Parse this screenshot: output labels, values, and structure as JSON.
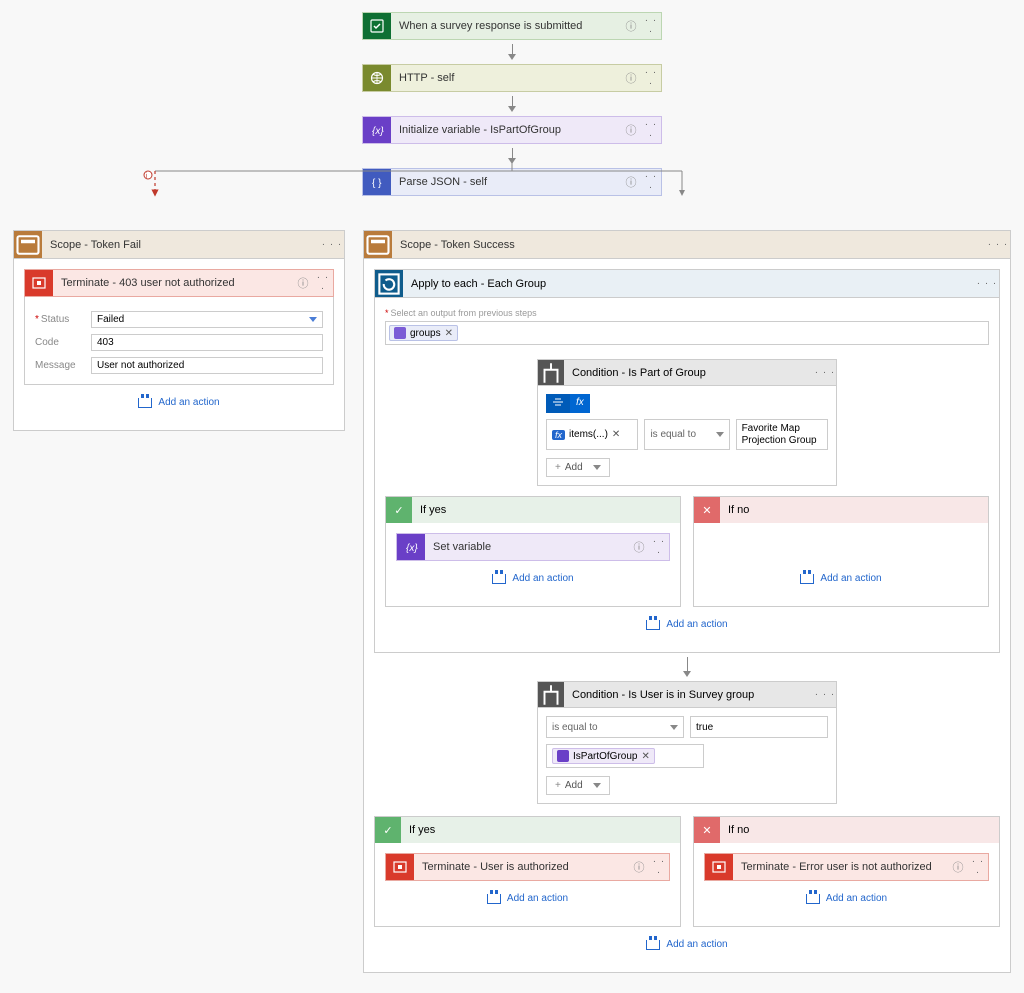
{
  "top": {
    "trigger": "When a survey response is submitted",
    "http": "HTTP - self",
    "initVar": "Initialize variable - IsPartOfGroup",
    "parse": "Parse JSON - self"
  },
  "scopeFail": {
    "title": "Scope - Token Fail",
    "terminate": {
      "title": "Terminate - 403 user not authorized",
      "fields": {
        "statusLabel": "Status",
        "status": "Failed",
        "codeLabel": "Code",
        "code": "403",
        "messageLabel": "Message",
        "message": "User not authorized"
      }
    },
    "addAction": "Add an action"
  },
  "scopeSuccess": {
    "title": "Scope - Token Success",
    "applyEach": {
      "title": "Apply to each - Each Group",
      "selectLabel": "Select an output from previous steps",
      "token": "groups",
      "condition": {
        "title": "Condition - Is Part of Group",
        "left": "items(...)",
        "op": "is equal to",
        "rightLine1": "Favorite Map",
        "rightLine2": "Projection Group",
        "add": "Add"
      },
      "yes": "If yes",
      "no": "If no",
      "setVar": "Set variable",
      "addAction": "Add an action"
    },
    "condition2": {
      "title": "Condition - Is User is in Survey group",
      "leftToken": "IsPartOfGroup",
      "op": "is equal to",
      "right": "true",
      "add": "Add"
    },
    "yes2": {
      "label": "If yes",
      "terminate": "Terminate - User is authorized"
    },
    "no2": {
      "label": "If no",
      "terminate": "Terminate - Error user is not authorized"
    },
    "addAction": "Add an action"
  },
  "info": "ⓘ",
  "dots": "· · ·",
  "closeX": "✕"
}
